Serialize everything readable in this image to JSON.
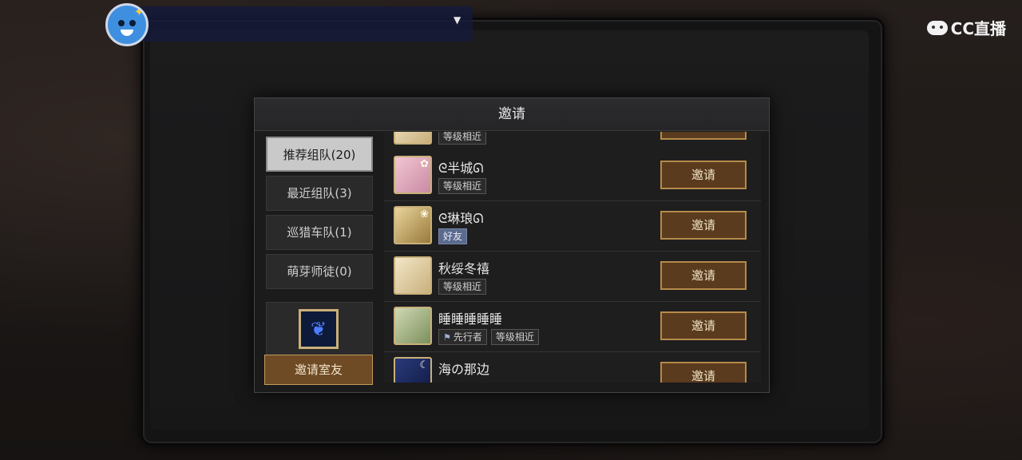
{
  "stream": {
    "logo_text": "CC直播"
  },
  "dialog": {
    "title": "邀请",
    "tabs": [
      {
        "label": "推荐组队(20)",
        "active": true
      },
      {
        "label": "最近组队(3)",
        "active": false
      },
      {
        "label": "巡猎车队(1)",
        "active": false
      },
      {
        "label": "萌芽师徒(0)",
        "active": false
      }
    ],
    "invite_roommate_label": "邀请室友"
  },
  "players": [
    {
      "name": "",
      "tags": [
        "等级相近"
      ],
      "invite_label": ""
    },
    {
      "name": "ᘓ半城ᘏ",
      "tags": [
        "等级相近"
      ],
      "invite_label": "邀请"
    },
    {
      "name": "ᘓ琳琅ᘏ",
      "tags": [
        "好友"
      ],
      "invite_label": "邀请"
    },
    {
      "name": "秋绥冬禧",
      "tags": [
        "等级相近"
      ],
      "invite_label": "邀请"
    },
    {
      "name": "睡睡睡睡睡",
      "tags": [
        "先行者",
        "等级相近"
      ],
      "invite_label": "邀请"
    },
    {
      "name": "海の那边",
      "tags": [],
      "invite_label": "邀请"
    }
  ],
  "icons": {
    "stream_avatar": "cartoon-avatar-icon",
    "dropdown": "caret-down-icon",
    "pioneer": "pioneer-badge-icon",
    "roommate": "butterfly-icon",
    "brand": "cc-cloud-icon"
  },
  "colors": {
    "invite_button_bg": "#5a3b1d",
    "invite_button_border": "#b58a4a",
    "active_tab_bg": "#c9c9c9",
    "friend_tag_bg": "#5b6a8f"
  }
}
